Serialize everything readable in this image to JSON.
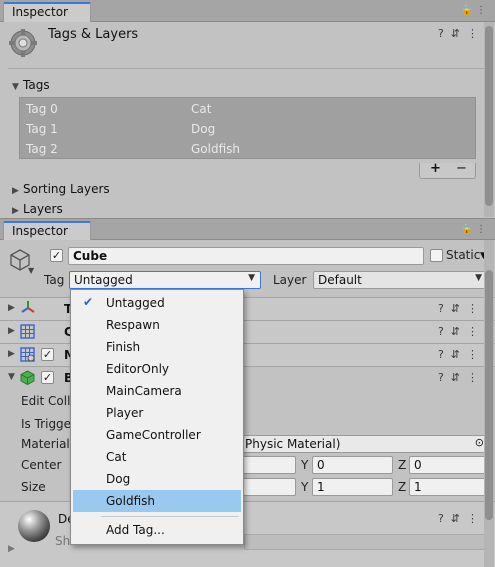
{
  "top_inspector": {
    "tab_label": "Inspector",
    "title": "Tags & Layers",
    "tags_foldout": "Tags",
    "tags": [
      {
        "key": "Tag 0",
        "value": "Cat"
      },
      {
        "key": "Tag 1",
        "value": "Dog"
      },
      {
        "key": "Tag 2",
        "value": "Goldfish"
      }
    ],
    "add_symbol": "+",
    "remove_symbol": "−",
    "sorting_layers_foldout": "Sorting Layers",
    "layers_foldout": "Layers"
  },
  "bottom_inspector": {
    "tab_label": "Inspector",
    "object_name": "Cube",
    "static_label": "Static",
    "tag_label": "Tag",
    "tag_value": "Untagged",
    "layer_label": "Layer",
    "layer_value": "Default",
    "components": [
      {
        "initial": "T"
      },
      {
        "initial": "C"
      },
      {
        "initial": "M"
      },
      {
        "initial": "B"
      }
    ],
    "collider": {
      "edit_label": "Edit Colli",
      "is_trigger_label": "Is Trigge",
      "material_label": "Material",
      "material_value": "Physic Material)",
      "center_label": "Center",
      "size_label": "Size",
      "center": {
        "y_label": "Y",
        "y": "0",
        "z_label": "Z",
        "z": "0"
      },
      "size": {
        "y_label": "Y",
        "y": "1",
        "z_label": "Z",
        "z": "1"
      }
    },
    "material_name": "De",
    "shader_label": "Sha"
  },
  "tag_menu": {
    "items": [
      "Untagged",
      "Respawn",
      "Finish",
      "EditorOnly",
      "MainCamera",
      "Player",
      "GameController",
      "Cat",
      "Dog",
      "Goldfish"
    ],
    "checked_item": "Untagged",
    "highlighted_item": "Goldfish",
    "add_tag": "Add Tag..."
  },
  "colors": {
    "accent": "#3a79d8",
    "menu_highlight": "#99c9ef",
    "tag_list_bg": "#a0a0a0"
  }
}
